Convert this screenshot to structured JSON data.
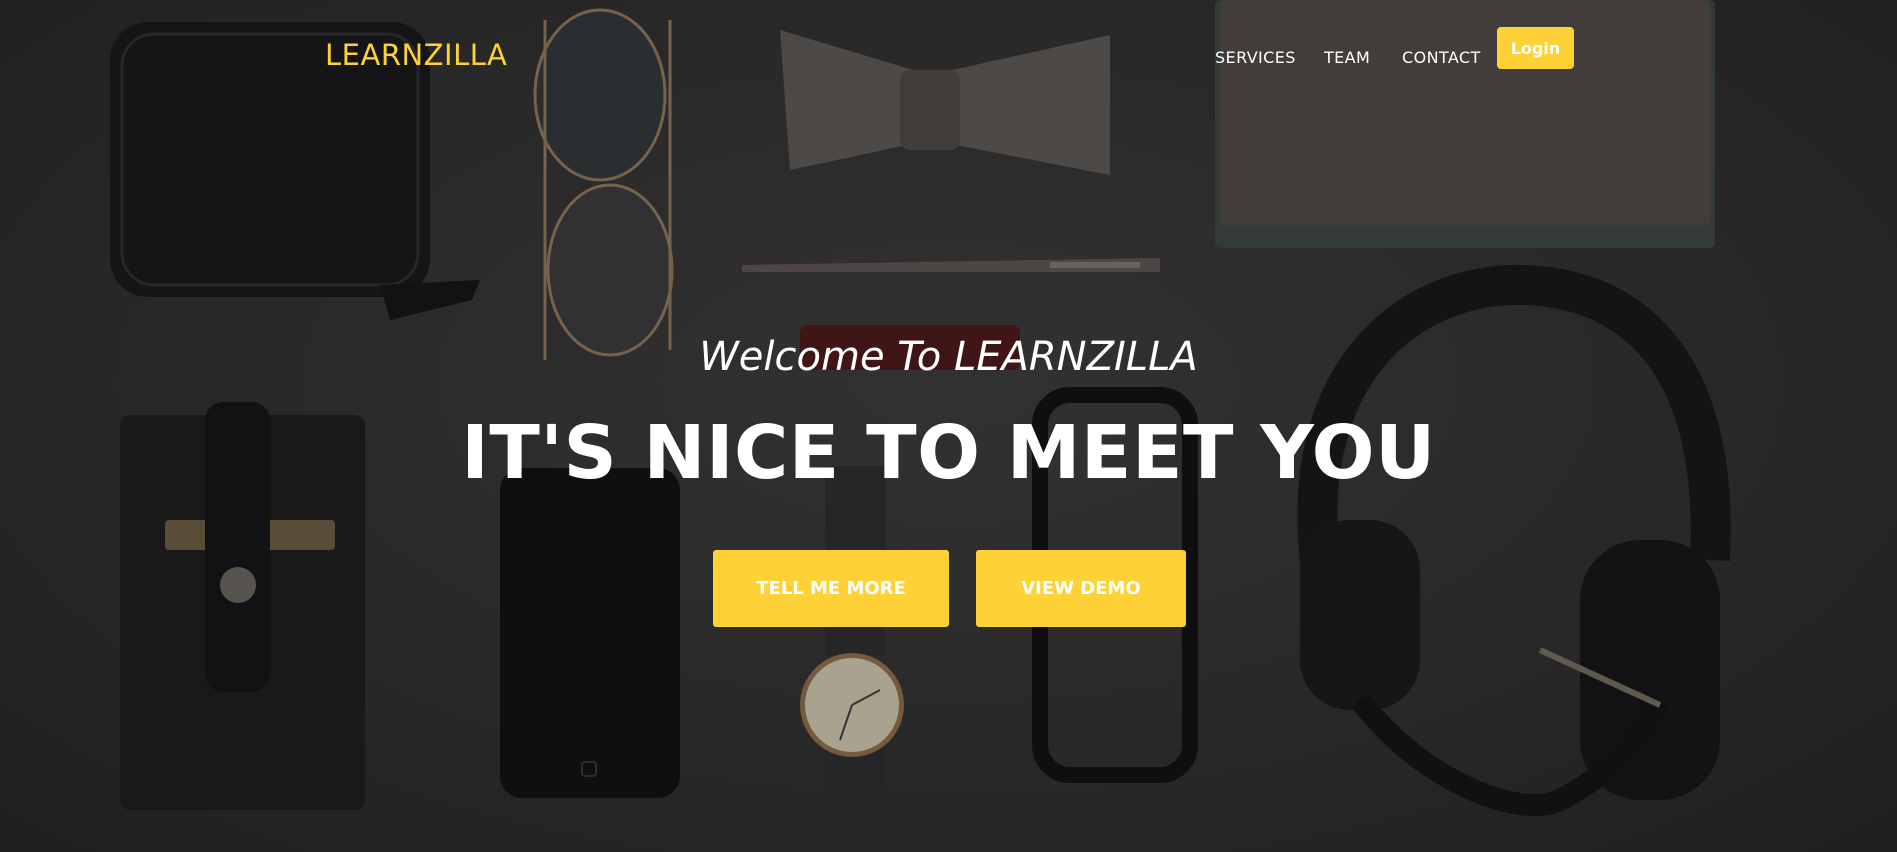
{
  "brand": {
    "name": "LEARNZILLA",
    "color": "#fed136"
  },
  "nav": {
    "items": [
      {
        "label": "SERVICES"
      },
      {
        "label": "TEAM"
      },
      {
        "label": "CONTACT"
      }
    ],
    "login_label": "Login"
  },
  "hero": {
    "welcome": "Welcome To LEARNZILLA",
    "headline": "IT'S NICE TO MEET YOU",
    "buttons": [
      {
        "label": "TELL ME MORE"
      },
      {
        "label": "VIEW DEMO"
      }
    ]
  },
  "colors": {
    "accent": "#fed136",
    "text": "#ffffff",
    "background": "#2e2d2d"
  }
}
